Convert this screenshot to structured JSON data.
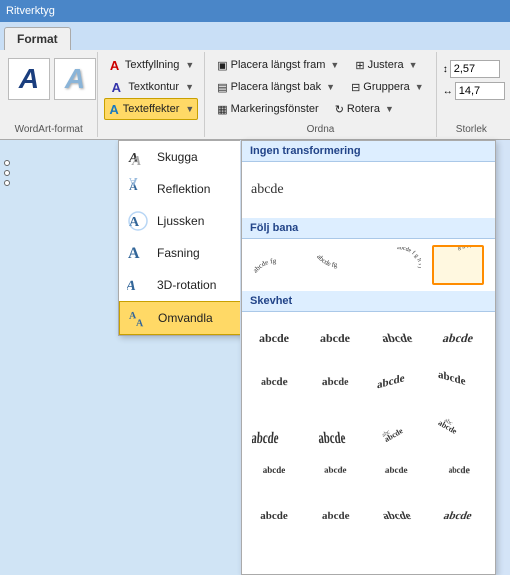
{
  "titlebar": {
    "label": "Ritverktyg"
  },
  "tabs": {
    "active": "Format"
  },
  "ribbon": {
    "wordart_section_label": "WordArt-format",
    "text_fill_label": "Textfyllning",
    "text_outline_label": "Textkontur",
    "text_effects_label": "Texteffekter",
    "place_front_label": "Placera längst fram",
    "place_back_label": "Placera längst bak",
    "selection_window_label": "Markeringsfönster",
    "justify_label": "Justera",
    "group_label": "Gruppera",
    "rotate_label": "Rotera",
    "ordna_label": "Ordna",
    "size_value1": "2,57",
    "size_value2": "14,7",
    "storlek_label": "Storlek"
  },
  "dropdown": {
    "items": [
      {
        "id": "skugga",
        "label": "Skugga",
        "has_arrow": true
      },
      {
        "id": "reflektion",
        "label": "Reflektion",
        "has_arrow": true
      },
      {
        "id": "ljussken",
        "label": "Ljussken",
        "has_arrow": true
      },
      {
        "id": "fasning",
        "label": "Fasning",
        "has_arrow": true
      },
      {
        "id": "3d-rotation",
        "label": "3D-rotation",
        "has_arrow": true
      },
      {
        "id": "omvandla",
        "label": "Omvandla",
        "has_arrow": true,
        "highlighted": true
      }
    ]
  },
  "flyout": {
    "sections": [
      {
        "id": "ingen-transformering",
        "title": "Ingen transformering",
        "items": [
          {
            "id": "no-transform",
            "label": "abcde",
            "type": "plain"
          }
        ]
      },
      {
        "id": "folj-bana",
        "title": "Följ bana",
        "items": [
          {
            "id": "arch-up",
            "label": "arch-up",
            "type": "arch-up"
          },
          {
            "id": "arch-down",
            "label": "arch-down",
            "type": "arch-down"
          },
          {
            "id": "circle-cw",
            "label": "circle-cw",
            "type": "circle"
          },
          {
            "id": "circle-ccw",
            "label": "circle-ccw",
            "type": "circle2"
          }
        ]
      },
      {
        "id": "skevhet",
        "title": "Skevhet",
        "rows": [
          [
            "abcde",
            "abcde",
            "abcde",
            "abcde"
          ],
          [
            "abcde",
            "abcde",
            "abcde",
            "abcde"
          ],
          [
            "abcde",
            "abcde",
            "abcde",
            "abcde"
          ],
          [
            "abcde",
            "abcde",
            "abcde",
            "abcde"
          ]
        ]
      }
    ]
  }
}
